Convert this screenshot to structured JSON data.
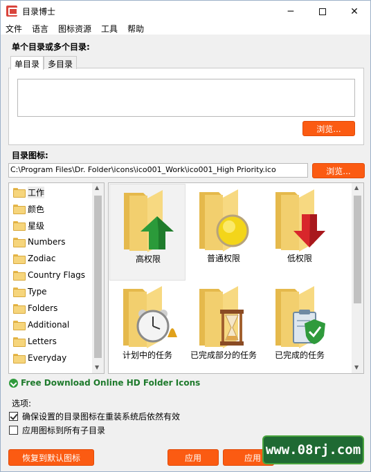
{
  "window": {
    "title": "目录博士"
  },
  "menu": [
    "文件",
    "语言",
    "图标资源",
    "工具",
    "帮助"
  ],
  "section_dirs": {
    "label": "单个目录或多个目录:",
    "tabs": [
      "单目录",
      "多目录"
    ],
    "browse_label": "浏览..."
  },
  "section_icon": {
    "label": "目录图标:",
    "path_value": "C:\\Program Files\\Dr. Folder\\icons\\ico001_Work\\ico001_High Priority.ico",
    "browse_label": "浏览..."
  },
  "tree": {
    "items": [
      "工作",
      "颜色",
      "星级",
      "Numbers",
      "Zodiac",
      "Country Flags",
      "Type",
      "Folders",
      "Additional",
      "Letters",
      "Everyday"
    ],
    "selected": "工作"
  },
  "icons": [
    {
      "label": "高权限",
      "icon": "folder-up-arrow-icon"
    },
    {
      "label": "普通权限",
      "icon": "folder-circle-icon"
    },
    {
      "label": "低权限",
      "icon": "folder-down-arrow-icon"
    },
    {
      "label": "计划中的任务",
      "icon": "folder-clock-icon"
    },
    {
      "label": "已完成部分的任务",
      "icon": "folder-hourglass-icon"
    },
    {
      "label": "已完成的任务",
      "icon": "folder-clipboard-check-icon"
    }
  ],
  "download_link": "Free Download Online HD Folder Icons",
  "options": {
    "label": "选项:",
    "items": [
      {
        "label": "确保设置的目录图标在重装系统后依然有效",
        "checked": true
      },
      {
        "label": "应用图标到所有子目录",
        "checked": false
      }
    ]
  },
  "buttons": {
    "restore": "恢复到默认图标",
    "apply": "应用",
    "apply2": "应用"
  },
  "watermark": "www.08rj.com",
  "colors": {
    "accent": "#fb5b12",
    "link": "#1e7a2c"
  }
}
